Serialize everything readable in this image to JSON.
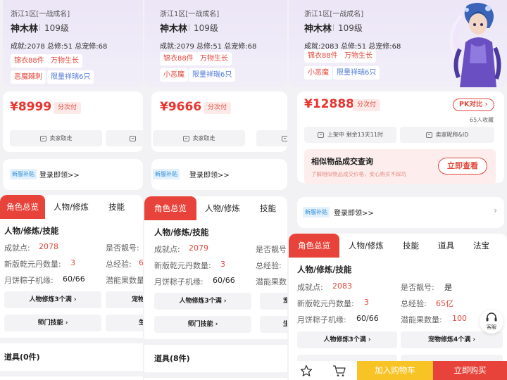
{
  "panels": [
    {
      "server": "浙江1区[一战成名]",
      "name": "神木林",
      "level": "109级",
      "stats": "成就:2078 总修:51 总宠修:68",
      "tags": [
        "锦衣88件",
        "万物生长",
        "恶魔棘刺",
        "限量祥瑞6只"
      ],
      "price": "¥8999",
      "installment": "分次付",
      "seller_fetch": "卖家取走",
      "promo_badge": "新服补贴",
      "promo_text": "登录即领>>",
      "tabs": [
        "角色总览",
        "人物/修炼",
        "技能"
      ],
      "section_title": "人物/修炼/技能",
      "achievement_label": "成就点:",
      "achievement_value": "2078",
      "pretty_label": "是否靓号:",
      "qianyuan_label": "新版乾元丹数量:",
      "qianyuan_value": "3",
      "total_exp_label": "总经验:",
      "total_exp_value": "6",
      "zongzi_label": "月饼粽子机缘:",
      "zongzi_value": "60/66",
      "potential_label": "潜能果数量",
      "btn_person": "人物修炼3个满 ›",
      "btn_pet": "宠物",
      "btn_master": "师门技能 ›",
      "btn_life": "生",
      "daoju": "道具(0件)"
    },
    {
      "server": "浙江1区[一战成名]",
      "name": "神木林",
      "level": "109级",
      "stats": "成就:2079 总修:51 总宠修:68",
      "tags": [
        "锦衣88件",
        "万物生长",
        "小恶魔",
        "限量祥瑞6只"
      ],
      "price": "¥9666",
      "installment": "分次付",
      "seller_fetch": "卖家取走",
      "promo_badge": "新服补贴",
      "promo_text": "登录即领>>",
      "tabs": [
        "角色总览",
        "人物/修炼",
        "技能"
      ],
      "section_title": "人物/修炼/技能",
      "achievement_label": "成就点:",
      "achievement_value": "2079",
      "pretty_label": "是否靓号",
      "qianyuan_label": "新版乾元丹数量:",
      "qianyuan_value": "3",
      "total_exp_label": "总经验:",
      "zongzi_label": "月饼粽子机缘:",
      "zongzi_value": "60/66",
      "potential_label": "潜能果数",
      "btn_person": "人物修炼3个满 ›",
      "btn_pet": "宠",
      "btn_master": "师门技能 ›",
      "btn_life": "生",
      "daoju": "道具(8件)"
    },
    {
      "server": "浙江1区[一战成名]",
      "name": "神木林",
      "level": "109级",
      "stats": "成就:2083 总修:51 总宠修:68",
      "tags": [
        "锦衣88件",
        "万物生长",
        "小恶魔",
        "限量祥瑞6只"
      ],
      "price": "¥12888",
      "installment": "分次付",
      "pk": "PK对比 ›",
      "favorites": "65人收藏",
      "on_shelf": "上架中 剩余13天11时",
      "seller_name": "卖家昵称&ID",
      "similar_title": "相似物品成交查询",
      "similar_desc": "了解相似物品成交价格，安心购买不踩坑",
      "similar_btn": "立即查看",
      "promo_badge": "新服补贴",
      "promo_text": "登录即领>>",
      "tabs": [
        "角色总览",
        "人物/修炼",
        "技能",
        "道具",
        "法宝"
      ],
      "section_title": "人物/修炼/技能",
      "achievement_label": "成就点:",
      "achievement_value": "2083",
      "pretty_label": "是否靓号:",
      "pretty_value": "是",
      "qianyuan_label": "新版乾元丹数量:",
      "qianyuan_value": "3",
      "total_exp_label": "总经验:",
      "total_exp_value": "65亿",
      "zongzi_label": "月饼粽子机缘:",
      "zongzi_value": "60/66",
      "potential_label": "潜能果数量:",
      "potential_value": "100",
      "btn_person": "人物修炼3个满 ›",
      "btn_pet": "宠物修炼4个满 ›",
      "service_label": "客服",
      "add_cart": "加入购物车",
      "buy_now": "立即购买"
    }
  ],
  "colors": {
    "accent": "#e8433a",
    "price": "#e7352f",
    "cart": "#f7c325",
    "header_bg": "#ece6f7"
  }
}
